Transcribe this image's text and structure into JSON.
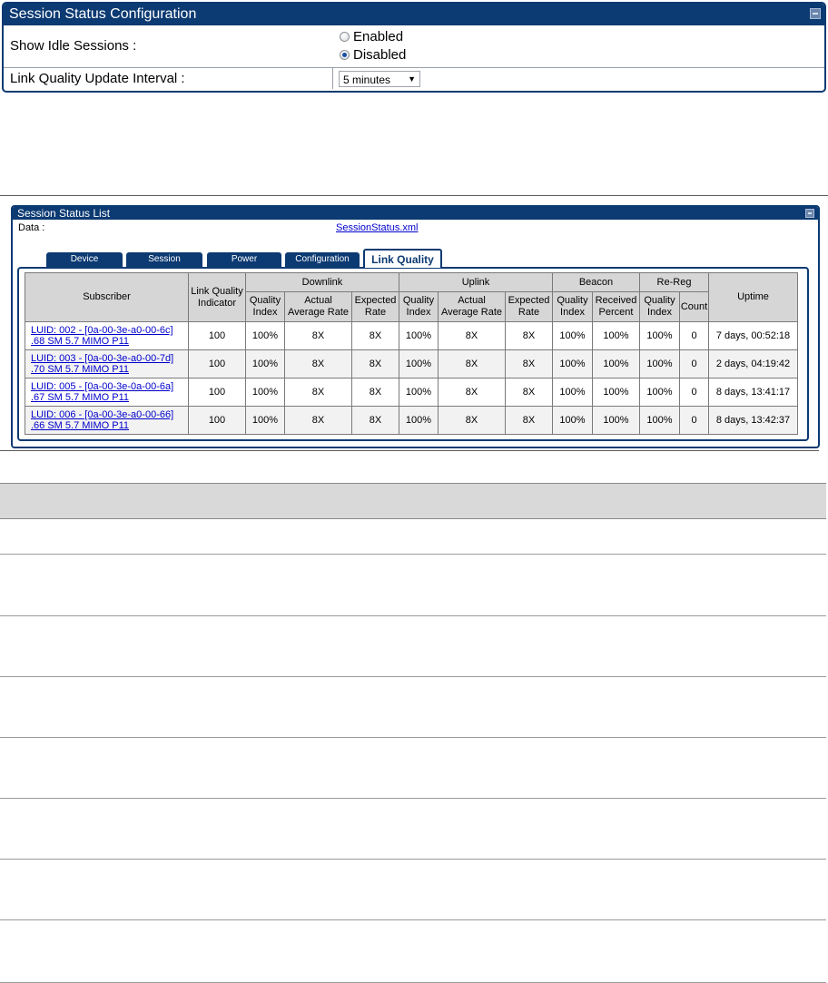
{
  "config_panel": {
    "title": "Session Status Configuration",
    "idle_sessions_label": "Show Idle Sessions :",
    "idle_options": [
      {
        "label": "Enabled",
        "checked": false
      },
      {
        "label": "Disabled",
        "checked": true
      }
    ],
    "link_quality_label": "Link Quality Update Interval :",
    "update_interval_value": "5 minutes"
  },
  "list_panel": {
    "title": "Session Status List",
    "data_label": "Data :",
    "data_link": "SessionStatus.xml",
    "tabs": [
      {
        "label": "Device",
        "active": false
      },
      {
        "label": "Session",
        "active": false
      },
      {
        "label": "Power",
        "active": false
      },
      {
        "label": "Configuration",
        "active": false
      },
      {
        "label": "Link Quality",
        "active": true
      }
    ],
    "table": {
      "group_headers": [
        "Downlink",
        "Uplink",
        "Beacon",
        "Re-Reg"
      ],
      "header_subscriber": "Subscriber",
      "header_lqi": "Link Quality Indicator",
      "header_uptime": "Uptime",
      "downlink_cols": [
        "Quality Index",
        "Actual Average Rate",
        "Expected Rate"
      ],
      "uplink_cols": [
        "Quality Index",
        "Actual Average Rate",
        "Expected Rate"
      ],
      "beacon_cols": [
        "Quality Index",
        "Received Percent"
      ],
      "rereg_cols": [
        "Quality Index",
        "Count"
      ],
      "rows": [
        {
          "line1": "LUID: 002 - [0a-00-3e-a0-00-6c]",
          "line2": ".68 SM 5.7 MIMO P11",
          "lqi": "100",
          "dl_qi": "100%",
          "dl_actual": "8X",
          "dl_expected": "8X",
          "ul_qi": "100%",
          "ul_actual": "8X",
          "ul_expected": "8X",
          "bc_qi": "100%",
          "bc_recv": "100%",
          "rr_qi": "100%",
          "rr_count": "0",
          "uptime": "7 days, 00:52:18"
        },
        {
          "line1": "LUID: 003 - [0a-00-3e-a0-00-7d]",
          "line2": ".70 SM 5.7 MIMO P11",
          "lqi": "100",
          "dl_qi": "100%",
          "dl_actual": "8X",
          "dl_expected": "8X",
          "ul_qi": "100%",
          "ul_actual": "8X",
          "ul_expected": "8X",
          "bc_qi": "100%",
          "bc_recv": "100%",
          "rr_qi": "100%",
          "rr_count": "0",
          "uptime": "2 days, 04:19:42"
        },
        {
          "line1": "LUID: 005 - [0a-00-3e-0a-00-6a]",
          "line2": ".67 SM 5.7 MIMO P11",
          "lqi": "100",
          "dl_qi": "100%",
          "dl_actual": "8X",
          "dl_expected": "8X",
          "ul_qi": "100%",
          "ul_actual": "8X",
          "ul_expected": "8X",
          "bc_qi": "100%",
          "bc_recv": "100%",
          "rr_qi": "100%",
          "rr_count": "0",
          "uptime": "8 days, 13:41:17"
        },
        {
          "line1": "LUID: 006 - [0a-00-3e-a0-00-66]",
          "line2": ".66 SM 5.7 MIMO P11",
          "lqi": "100",
          "dl_qi": "100%",
          "dl_actual": "8X",
          "dl_expected": "8X",
          "ul_qi": "100%",
          "ul_actual": "8X",
          "ul_expected": "8X",
          "bc_qi": "100%",
          "bc_recv": "100%",
          "rr_qi": "100%",
          "rr_count": "0",
          "uptime": "8 days, 13:42:37"
        }
      ]
    }
  },
  "colors": {
    "panel_blue": "#0c3a72",
    "header_gray": "#d6d6d6",
    "link_blue": "#0000cc"
  }
}
